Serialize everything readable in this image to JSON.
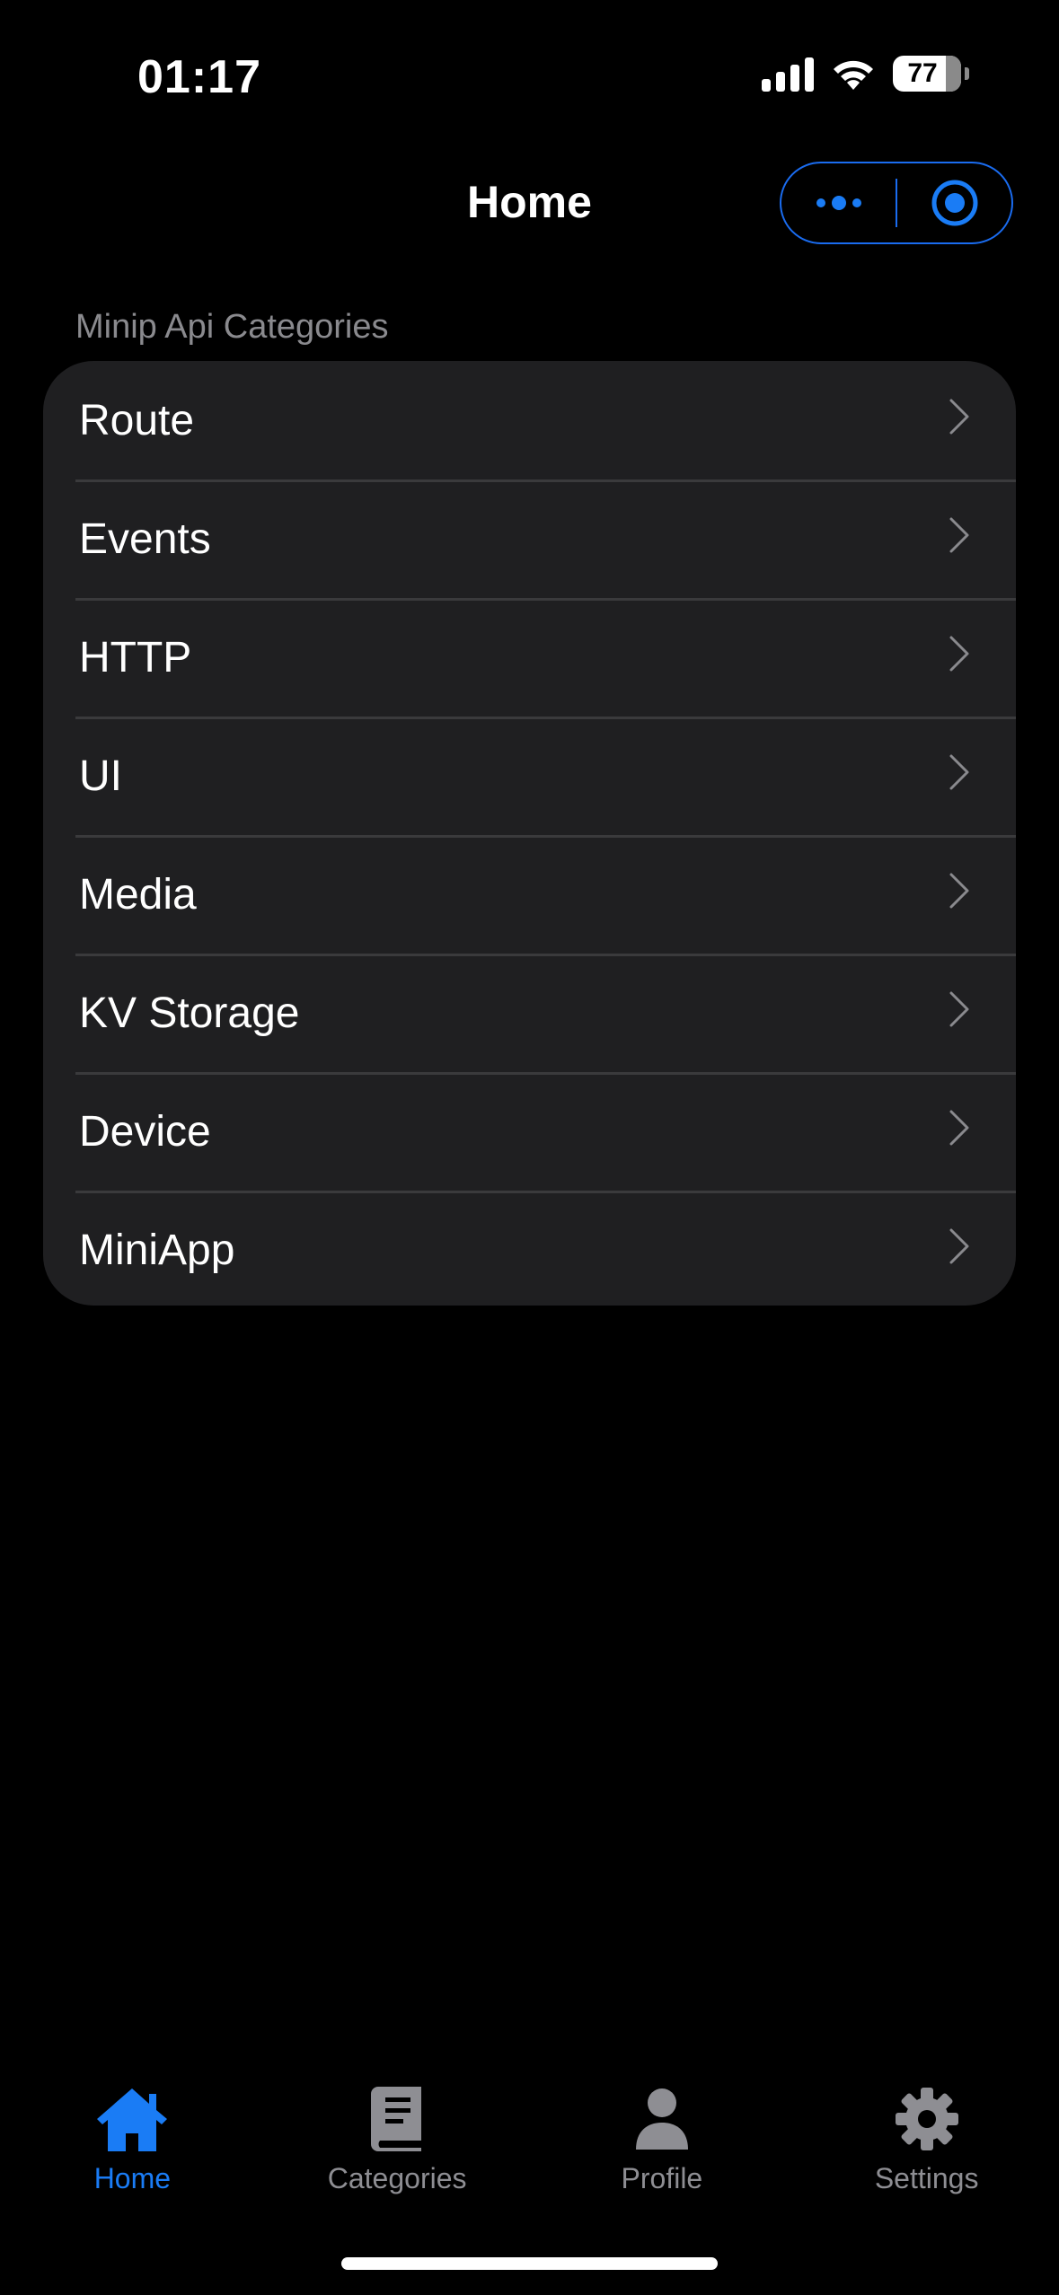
{
  "status_bar": {
    "time": "01:17",
    "battery": "77",
    "battery_level_percent": 77
  },
  "header": {
    "title": "Home",
    "capsule_more_icon": "more-dots-icon",
    "capsule_close_icon": "target-circle-icon"
  },
  "section": {
    "label": "Minip Api Categories"
  },
  "items": [
    {
      "label": "Route"
    },
    {
      "label": "Events"
    },
    {
      "label": "HTTP"
    },
    {
      "label": "UI"
    },
    {
      "label": "Media"
    },
    {
      "label": "KV Storage"
    },
    {
      "label": "Device"
    },
    {
      "label": "MiniApp"
    }
  ],
  "tabbar": {
    "tabs": [
      {
        "label": "Home",
        "icon": "home-icon",
        "active": true
      },
      {
        "label": "Categories",
        "icon": "book-icon",
        "active": false
      },
      {
        "label": "Profile",
        "icon": "person-icon",
        "active": false
      },
      {
        "label": "Settings",
        "icon": "gear-icon",
        "active": false
      }
    ]
  },
  "colors": {
    "accent": "#1a7cf5",
    "background": "#000000",
    "card": "#1f1f21",
    "inactive": "#8e8e93"
  }
}
